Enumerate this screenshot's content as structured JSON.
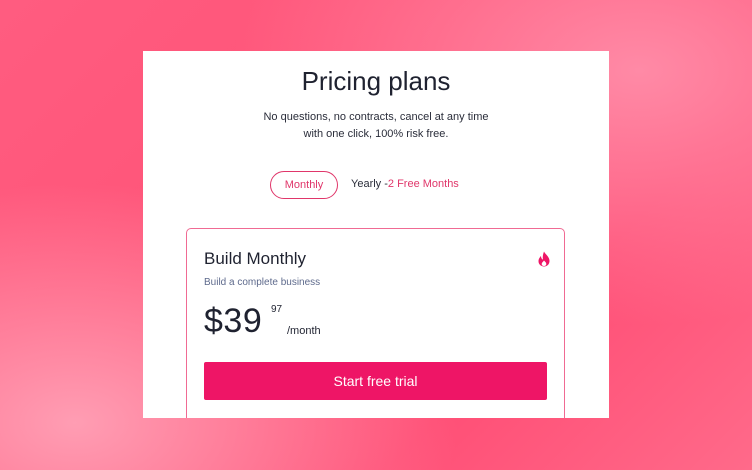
{
  "header": {
    "title": "Pricing plans",
    "subtitle_line1": "No questions, no contracts, cancel at any time",
    "subtitle_line2": "with one click, 100% risk free."
  },
  "billing_toggle": {
    "monthly_label": "Monthly",
    "yearly_label": "Yearly -",
    "yearly_promo": "2 Free Months",
    "selected": "Monthly"
  },
  "plan": {
    "name": "Build Monthly",
    "description": "Build a complete business",
    "price_main": "$39",
    "price_cents": "97",
    "period": "/month",
    "icon": "flame-icon",
    "cta_label": "Start free trial"
  },
  "colors": {
    "accent": "#e0366a",
    "button": "#ee1566",
    "background": "#ff5478"
  }
}
